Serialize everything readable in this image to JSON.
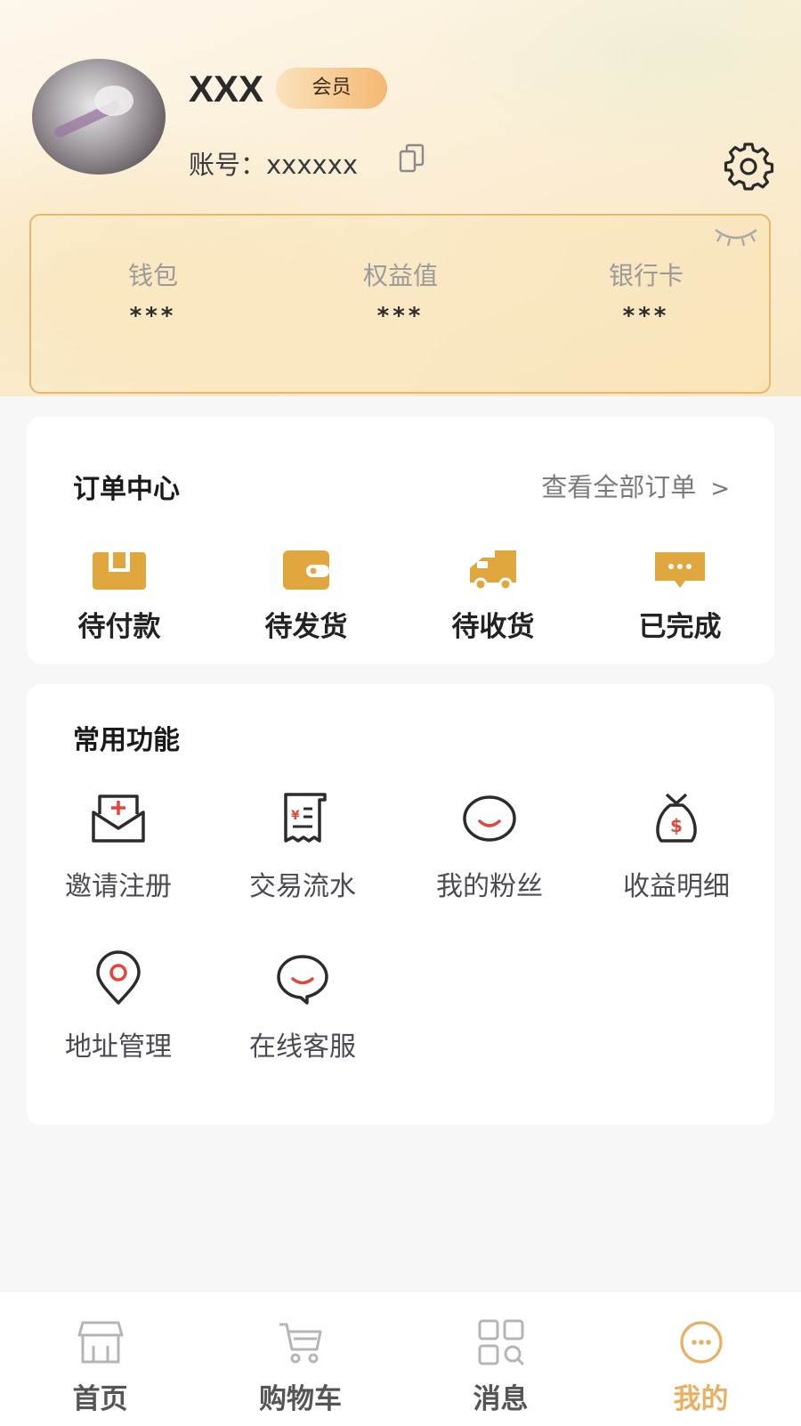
{
  "profile": {
    "name": "XXX",
    "badge": "会员",
    "account_label": "账号：",
    "account_value": "xxxxxx"
  },
  "wallet": {
    "items": [
      {
        "label": "钱包",
        "value": "***"
      },
      {
        "label": "权益值",
        "value": "***"
      },
      {
        "label": "银行卡",
        "value": "***"
      }
    ]
  },
  "orders": {
    "title": "订单中心",
    "view_all": "查看全部订单",
    "items": [
      {
        "label": "待付款",
        "icon": "wallet-box-icon"
      },
      {
        "label": "待发货",
        "icon": "wallet-icon"
      },
      {
        "label": "待收货",
        "icon": "truck-icon"
      },
      {
        "label": "已完成",
        "icon": "chat-bubble-icon"
      }
    ]
  },
  "functions": {
    "title": "常用功能",
    "items": [
      {
        "label": "邀请注册",
        "icon": "invite-mail-icon"
      },
      {
        "label": "交易流水",
        "icon": "receipt-icon"
      },
      {
        "label": "我的粉丝",
        "icon": "smile-icon"
      },
      {
        "label": "收益明细",
        "icon": "money-bag-icon"
      },
      {
        "label": "地址管理",
        "icon": "location-pin-icon"
      },
      {
        "label": "在线客服",
        "icon": "customer-service-icon"
      }
    ]
  },
  "tabbar": {
    "items": [
      {
        "label": "首页",
        "icon": "shop-icon"
      },
      {
        "label": "购物车",
        "icon": "cart-icon"
      },
      {
        "label": "消息",
        "icon": "grid-search-icon"
      },
      {
        "label": "我的",
        "icon": "profile-face-icon"
      }
    ],
    "active_index": 3
  },
  "colors": {
    "accent": "#e9b064",
    "order_icon": "#e0a73f",
    "function_red": "#e5463a",
    "function_stroke": "#2c2c2c"
  }
}
